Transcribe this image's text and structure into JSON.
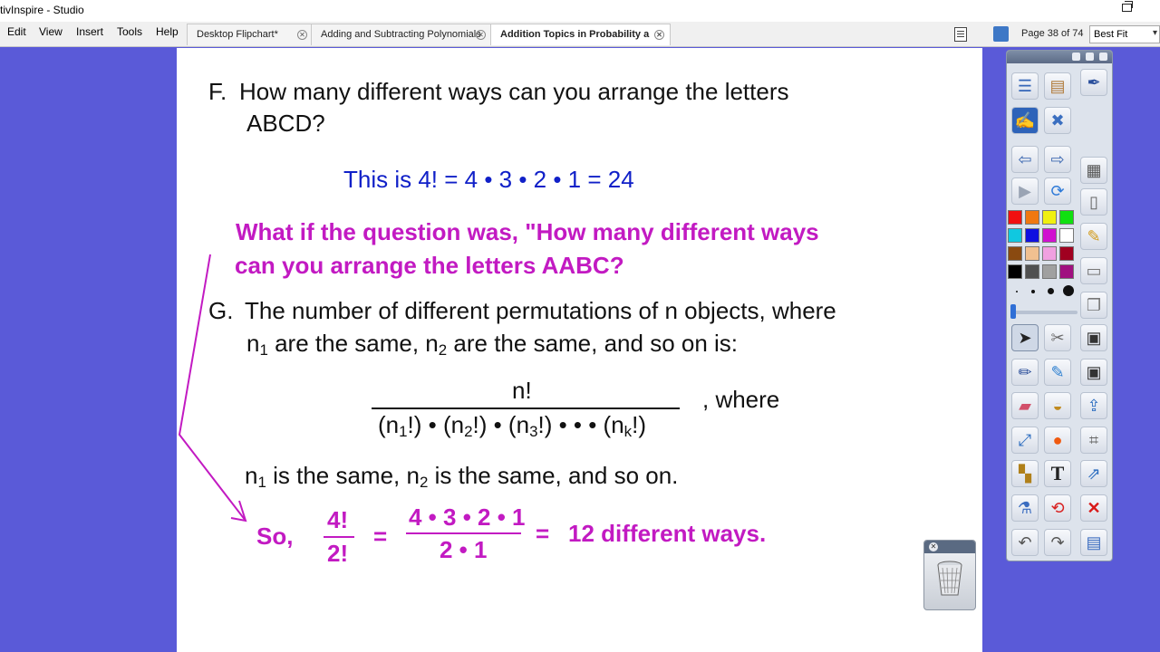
{
  "window": {
    "title": "tivInspire - Studio"
  },
  "menu": [
    "Edit",
    "View",
    "Insert",
    "Tools",
    "Help"
  ],
  "tabs": [
    {
      "label": "Desktop Flipchart*",
      "active": false
    },
    {
      "label": "Adding and Subtracting Polynomials",
      "active": false
    },
    {
      "label": "Addition Topics in Probability a",
      "active": true
    }
  ],
  "navigation": {
    "page_indicator": "Page 38 of 74",
    "zoom": "Best Fit"
  },
  "flipchart": {
    "question_f": {
      "label": "F.",
      "line1": "How many different ways can you arrange the letters",
      "line2": "ABCD?"
    },
    "answer_f": "This is 4!  =  4 • 3 • 2 • 1  =  24",
    "what_if": {
      "line1": "What if the question was, \"How many different ways",
      "line2": "can you arrange the letters AABC?"
    },
    "statement_g": {
      "label": "G.",
      "line1": "The number of different permutations of  n  objects, where",
      "line2_a": "n",
      "sub_1": "1",
      "line2_b": " are the same, n",
      "sub_2": "2",
      "line2_c": " are the same, and so on is:"
    },
    "formula": {
      "numerator": "n!",
      "den_parts": [
        "(n",
        "1",
        "!) • (n",
        "2",
        "!) • (n",
        "3",
        "!) • • • (n",
        "k",
        "!)"
      ],
      "where": ", where"
    },
    "definition": {
      "a": "n",
      "sub_1": "1",
      "b": " is the same, n",
      "sub_2": "2",
      "c": " is the same, and so on."
    },
    "conclusion": {
      "so": "So,",
      "frac1_num": "4!",
      "frac1_den": "2!",
      "eq1": "=",
      "frac2_num": "4 • 3 • 2 • 1",
      "frac2_den": "2 • 1",
      "eq2": "=",
      "result": "12 different ways."
    }
  },
  "toolbox": {
    "colors": [
      "#f01010",
      "#f07810",
      "#f0f010",
      "#10e010",
      "#10c8e0",
      "#1010e0",
      "#d010d0",
      "#ffffff",
      "#8a4a10",
      "#f0c090",
      "#f0a0e0",
      "#a00020",
      "#000000",
      "#505050",
      "#a0a0a0",
      "#a01080"
    ]
  },
  "colors": {
    "page_background": "#5a5ad8",
    "text_blue": "#1020c8",
    "text_magenta": "#c21ac2",
    "arrow": "#c21ac2"
  }
}
